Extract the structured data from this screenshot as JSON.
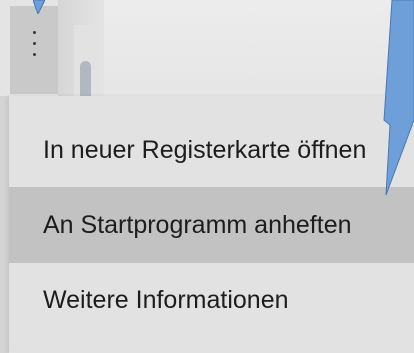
{
  "toolbar": {
    "more_button_icon": "more-vertical-icon"
  },
  "context_menu": {
    "items": [
      {
        "label": "In neuer Registerkarte öffnen",
        "highlighted": false
      },
      {
        "label": "An Startprogramm anheften",
        "highlighted": true
      },
      {
        "label": "Weitere Informationen",
        "highlighted": false
      }
    ]
  },
  "colors": {
    "menu_background": "#e2e2e2",
    "menu_highlight": "#c2c2c2",
    "arrow_blue": "#6f9fd8"
  }
}
